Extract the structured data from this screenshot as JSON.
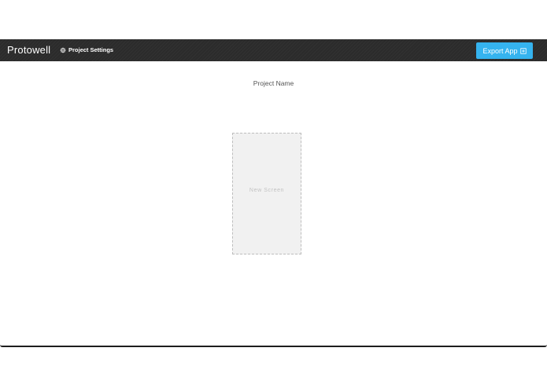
{
  "app": {
    "brand": "Protowell",
    "settings_label": "Project Settings",
    "settings_icon": "gear-icon",
    "export_label": "Export App",
    "export_icon": "export-box-icon",
    "accent_color": "#35b3ef",
    "topbar_color": "#2b2b2b"
  },
  "canvas": {
    "project_name": "Project Name",
    "new_screen_label": "New Screen"
  }
}
